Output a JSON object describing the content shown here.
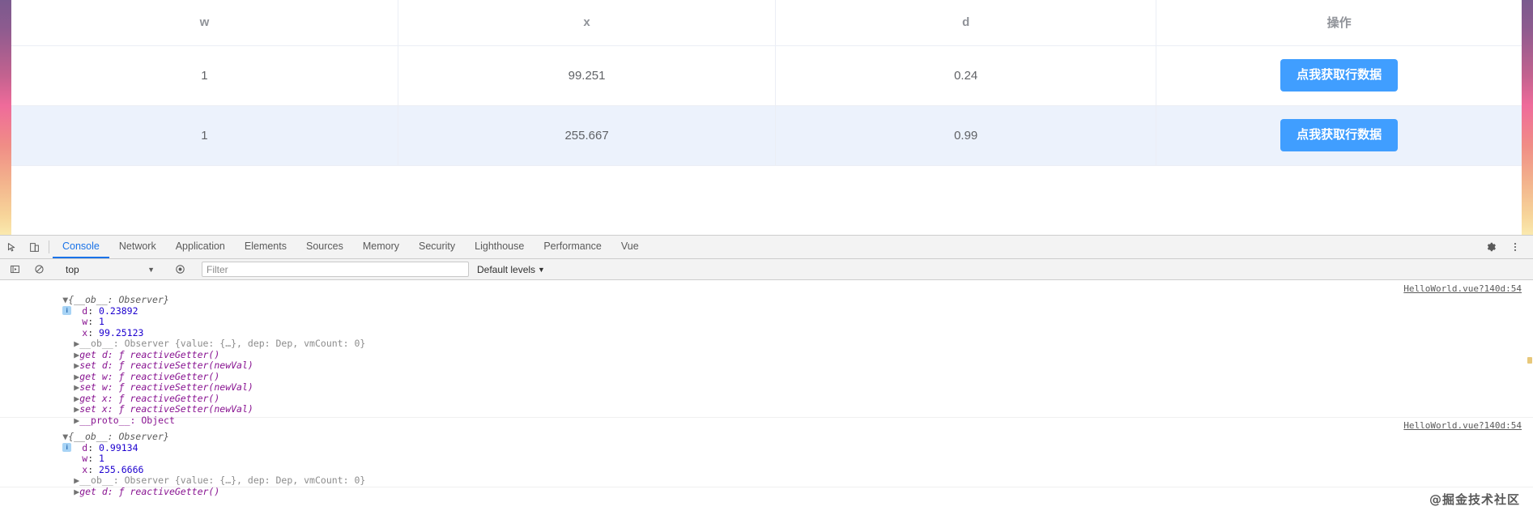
{
  "page": {
    "gradient": {
      "from": "#7a5a8e",
      "mid": "#ef6b9a",
      "to": "#fae9ae"
    },
    "table": {
      "headers": [
        "w",
        "x",
        "d",
        "操作"
      ],
      "rows": [
        {
          "w": "1",
          "x": "99.251",
          "d": "0.24",
          "action_label": "点我获取行数据"
        },
        {
          "w": "1",
          "x": "255.667",
          "d": "0.99",
          "action_label": "点我获取行数据"
        }
      ],
      "accent": "#409eff",
      "stripe": "#ecf2fc"
    }
  },
  "devtools": {
    "icons": {
      "inspect": "inspect-element-icon",
      "device": "device-toolbar-icon",
      "settings": "gear-icon",
      "more": "more-vertical-icon",
      "execute": "execute-icon",
      "clear": "clear-console-icon",
      "eye": "live-expression-icon"
    },
    "tabs": [
      {
        "label": "Console",
        "active": true
      },
      {
        "label": "Network",
        "active": false
      },
      {
        "label": "Application",
        "active": false
      },
      {
        "label": "Elements",
        "active": false
      },
      {
        "label": "Sources",
        "active": false
      },
      {
        "label": "Memory",
        "active": false
      },
      {
        "label": "Security",
        "active": false
      },
      {
        "label": "Lighthouse",
        "active": false
      },
      {
        "label": "Performance",
        "active": false
      },
      {
        "label": "Vue",
        "active": false
      }
    ],
    "toolbar": {
      "context": "top",
      "filter_placeholder": "Filter",
      "filter_value": "",
      "levels_label": "Default levels",
      "caret": "▼"
    },
    "console": {
      "source_link": "HelloWorld.vue?140d:54",
      "entries": [
        {
          "header": "{__ob__: Observer}",
          "props": [
            {
              "key": "d",
              "value": "0.23892",
              "kind": "num"
            },
            {
              "key": "w",
              "value": "1",
              "kind": "num"
            },
            {
              "key": "x",
              "value": "99.25123",
              "kind": "num"
            }
          ],
          "extras": [
            "__ob__: Observer {value: {…}, dep: Dep, vmCount: 0}",
            "get d: ƒ reactiveGetter()",
            "set d: ƒ reactiveSetter(newVal)",
            "get w: ƒ reactiveGetter()",
            "set w: ƒ reactiveSetter(newVal)",
            "get x: ƒ reactiveGetter()",
            "set x: ƒ reactiveSetter(newVal)",
            "__proto__: Object"
          ]
        },
        {
          "header": "{__ob__: Observer}",
          "props": [
            {
              "key": "d",
              "value": "0.99134",
              "kind": "num"
            },
            {
              "key": "w",
              "value": "1",
              "kind": "num"
            },
            {
              "key": "x",
              "value": "255.6666",
              "kind": "num"
            }
          ],
          "extras": [
            "__ob__: Observer {value: {…}, dep: Dep, vmCount: 0}",
            "get d: ƒ reactiveGetter()"
          ]
        }
      ]
    }
  },
  "watermark": {
    "text": "@掘金技术社区"
  }
}
